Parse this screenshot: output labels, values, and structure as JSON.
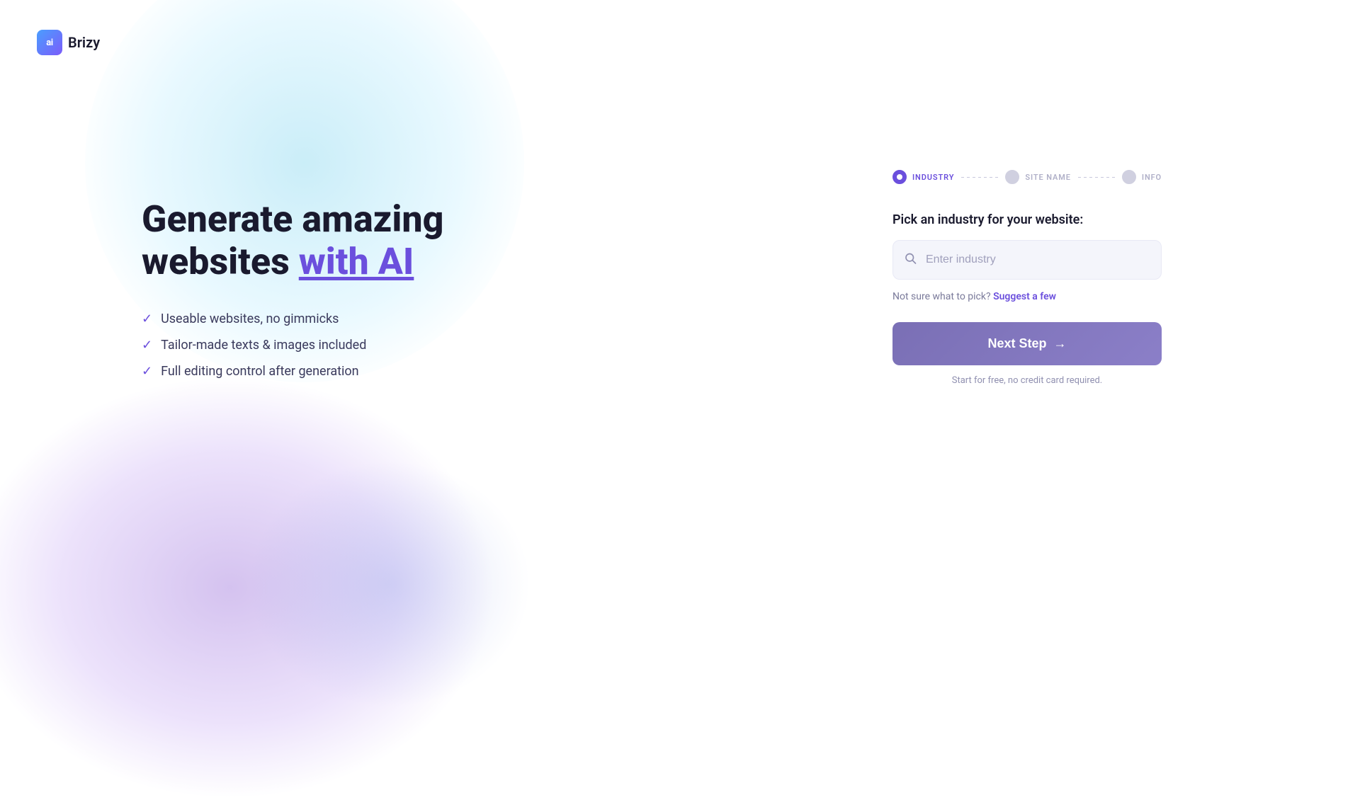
{
  "logo": {
    "icon_text": "ai",
    "name": "Brizy"
  },
  "headline": {
    "line1": "Generate amazing",
    "line2_normal": "websites ",
    "line2_highlight": "with AI"
  },
  "features": [
    {
      "text": "Useable websites, no gimmicks"
    },
    {
      "text": "Tailor-made texts & images included"
    },
    {
      "text": "Full editing control after generation"
    }
  ],
  "stepper": {
    "steps": [
      {
        "label": "INDUSTRY",
        "state": "active"
      },
      {
        "label": "SITE NAME",
        "state": "inactive"
      },
      {
        "label": "INFO",
        "state": "inactive"
      }
    ]
  },
  "form": {
    "pick_label": "Pick an industry for your website:",
    "input_placeholder": "Enter industry",
    "suggest_prefix": "Not sure what to pick?",
    "suggest_link": "Suggest a few"
  },
  "cta": {
    "next_step_label": "Next Step",
    "arrow": "→",
    "free_note": "Start for free, no credit card required."
  }
}
